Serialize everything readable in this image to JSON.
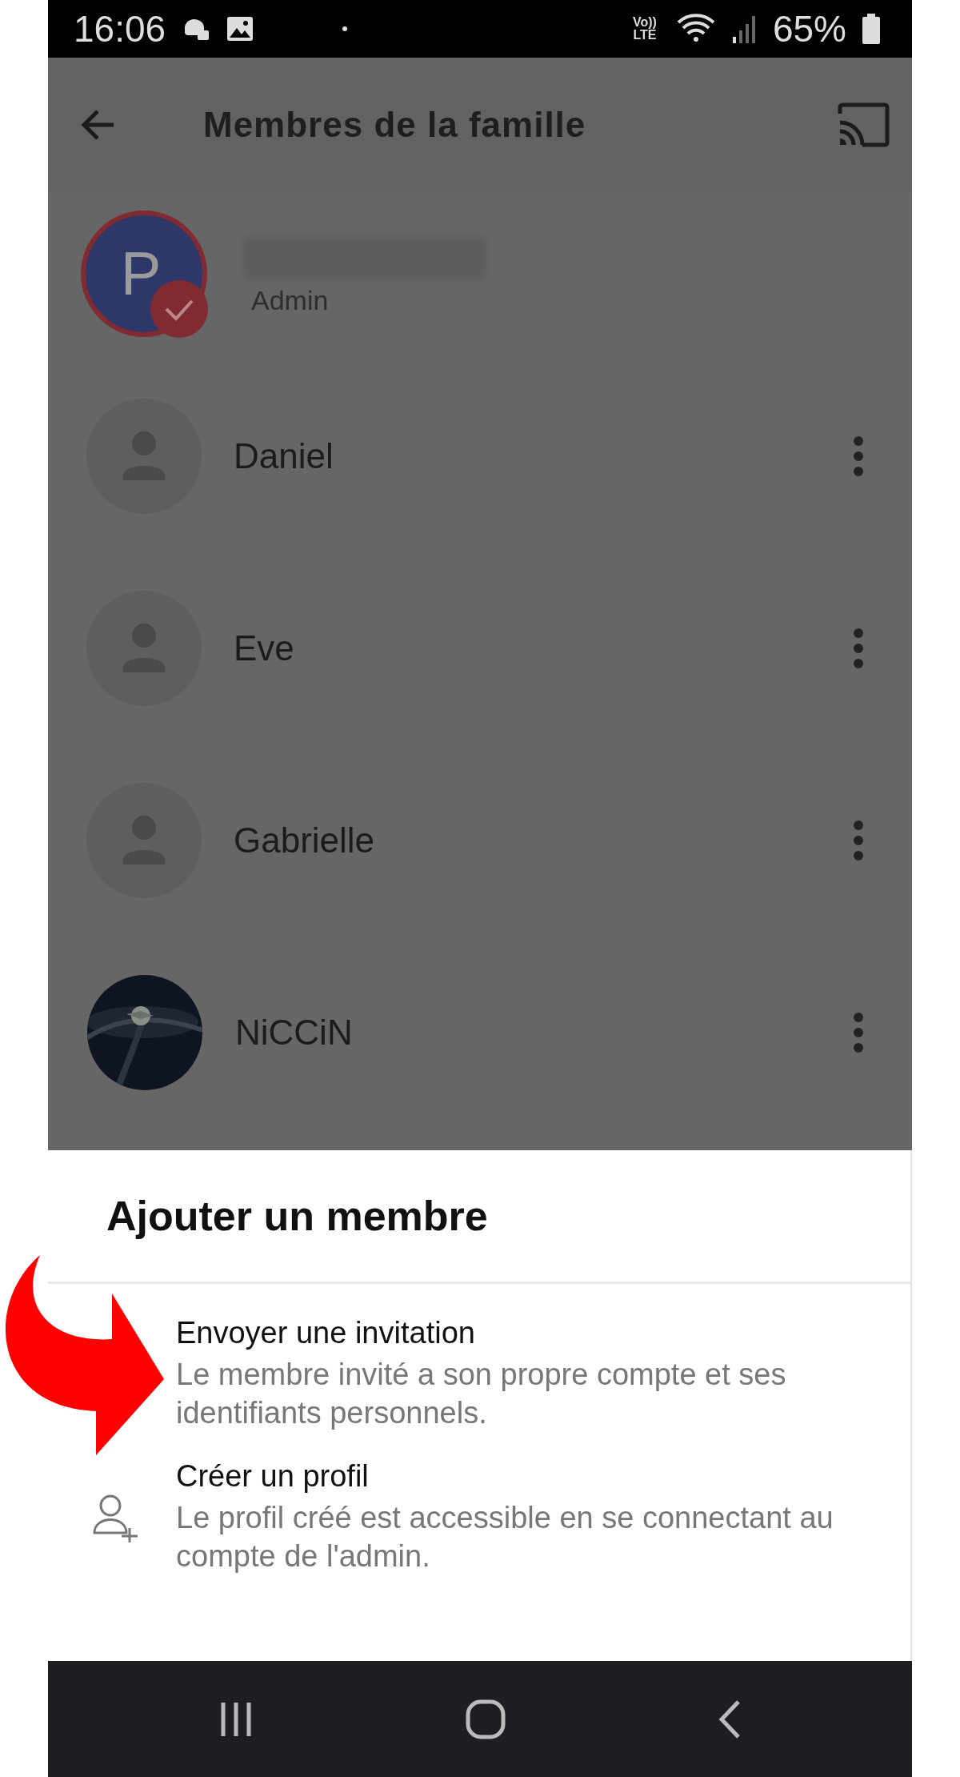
{
  "status_bar": {
    "time": "16:06",
    "network": "Vo)) LTE",
    "battery": "65%"
  },
  "app_bar": {
    "title": "Membres de la famille"
  },
  "members": [
    {
      "kind": "admin",
      "initial": "P",
      "role": "Admin"
    },
    {
      "kind": "placeholder",
      "name": "Daniel"
    },
    {
      "kind": "placeholder",
      "name": "Eve"
    },
    {
      "kind": "placeholder",
      "name": "Gabrielle"
    },
    {
      "kind": "picture",
      "name": "NiCCiN"
    }
  ],
  "sheet": {
    "title": "Ajouter un membre",
    "options": [
      {
        "kind": "invite",
        "title": "Envoyer une invitation",
        "description": "Le membre invité a son propre compte et ses identifiants personnels."
      },
      {
        "kind": "profile",
        "title": "Créer un profil",
        "description": "Le profil créé est accessible en se connectant au compte de l'admin."
      }
    ]
  }
}
